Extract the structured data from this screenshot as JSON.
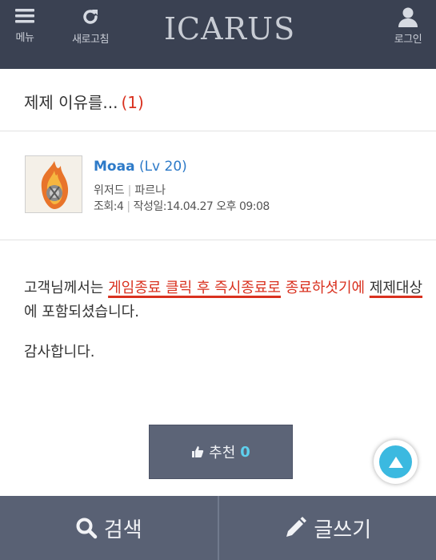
{
  "header": {
    "menu_label": "메뉴",
    "refresh_label": "새로고침",
    "logo_text": "ICARUS",
    "login_label": "로그인"
  },
  "post": {
    "title": "제제 이유를...",
    "comment_count": "(1)"
  },
  "author": {
    "nickname": "Moaa",
    "level": "(Lv 20)",
    "class": "위저드",
    "server": "파르나",
    "views": "조회:4",
    "date": "작성일:14.04.27 오후 09:08"
  },
  "content": {
    "part1": "고객님께서는 ",
    "highlight1": "게임종료 클릭 후 즉시종료로",
    "highlight2": " 종료하셧기에",
    "part2": " ",
    "underline2": "제제대상",
    "part3": "에 포함되셨습니다.",
    "thanks": "감사합니다."
  },
  "recommend": {
    "label": "추천",
    "count": "0"
  },
  "bottom": {
    "search_label": "검색",
    "write_label": "글쓰기"
  },
  "colors": {
    "header_bg": "#3a4152",
    "accent_red": "#d9311f",
    "link_blue": "#2d7ac8",
    "bottom_bg": "#596174",
    "top_button": "#3bb9e0"
  }
}
